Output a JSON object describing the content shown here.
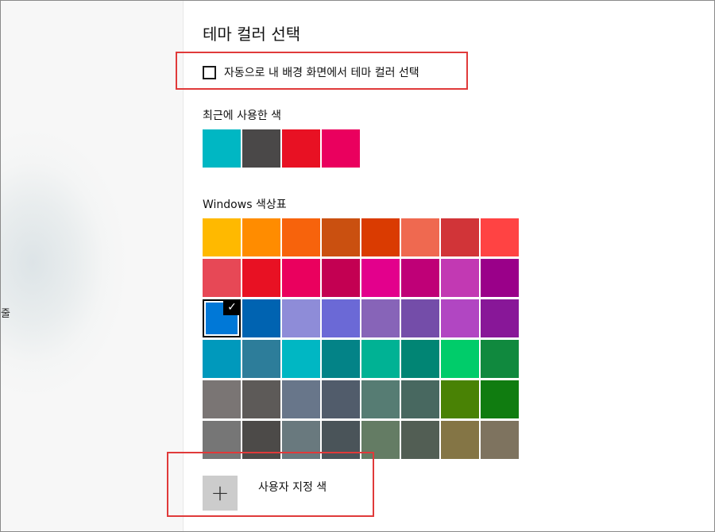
{
  "left_pane": {
    "cut_text": "줄"
  },
  "panel": {
    "title": "테마 컬러 선택",
    "auto_checkbox": {
      "label": "자동으로 내 배경 화면에서 테마 컬러 선택",
      "checked": false
    },
    "recent_label": "최근에 사용한 색",
    "recent_colors": [
      "#00b7c3",
      "#4a4848",
      "#e81123",
      "#ea005e"
    ],
    "palette_label": "Windows 색상표",
    "palette_colors": [
      [
        "#ffb900",
        "#ff8c00",
        "#f7630c",
        "#ca5010",
        "#da3b01",
        "#ef6950",
        "#d13438",
        "#ff4343"
      ],
      [
        "#e74856",
        "#e81123",
        "#ea005e",
        "#c30052",
        "#e3008c",
        "#bf0077",
        "#c239b3",
        "#9a0089"
      ],
      [
        "#0078d7",
        "#0063b1",
        "#8e8cd8",
        "#6b69d6",
        "#8764b8",
        "#744da9",
        "#b146c2",
        "#881798"
      ],
      [
        "#0099bc",
        "#2d7d9a",
        "#00b7c3",
        "#038387",
        "#00b294",
        "#018574",
        "#00cc6a",
        "#10893e"
      ],
      [
        "#7a7574",
        "#5d5a58",
        "#68768a",
        "#515c6b",
        "#567c73",
        "#486860",
        "#498205",
        "#107c10"
      ],
      [
        "#767676",
        "#4c4a48",
        "#69797e",
        "#4a5459",
        "#647c64",
        "#525e54",
        "#847545",
        "#7e735f"
      ]
    ],
    "selected": {
      "row": 2,
      "col": 0,
      "check_glyph": "✓"
    },
    "custom_color": {
      "plus_glyph": "+",
      "label": "사용자 지정 색"
    }
  },
  "highlight_color": "#e03a3a"
}
